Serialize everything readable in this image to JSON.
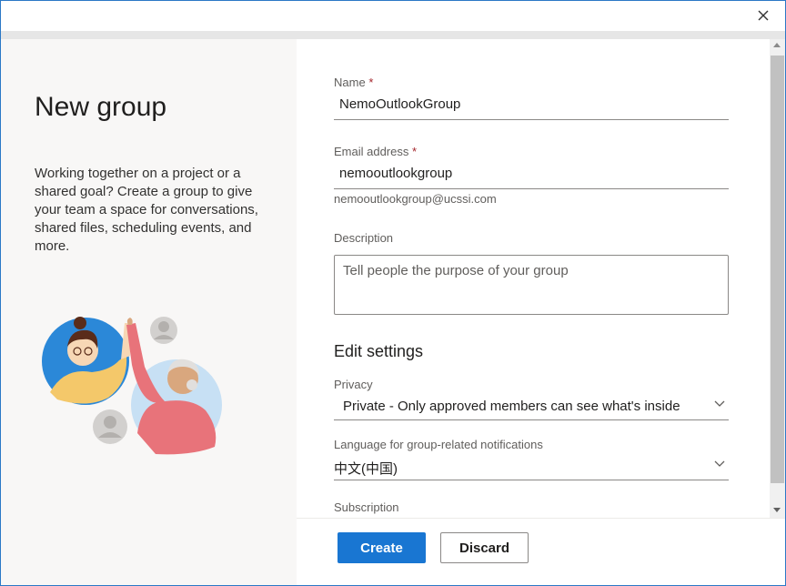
{
  "left": {
    "title": "New group",
    "description": "Working together on a project or a shared goal? Create a group to give your team a space for conversations, shared files, scheduling events, and more."
  },
  "form": {
    "name": {
      "label": "Name",
      "required_mark": "*",
      "value": "NemoOutlookGroup"
    },
    "email": {
      "label": "Email address",
      "required_mark": "*",
      "value": "nemooutlookgroup",
      "hint": "nemooutlookgroup@ucssi.com"
    },
    "description": {
      "label": "Description",
      "placeholder": "Tell people the purpose of your group"
    },
    "settings_title": "Edit settings",
    "privacy": {
      "label": "Privacy",
      "value": "Private - Only approved members can see what's inside"
    },
    "language": {
      "label": "Language for group-related notifications",
      "value": "中文(中国)"
    },
    "subscription": {
      "label": "Subscription"
    }
  },
  "footer": {
    "create_label": "Create",
    "discard_label": "Discard"
  },
  "icons": {
    "close": "close-icon",
    "chevron": "chevron-down-icon"
  },
  "colors": {
    "accent": "#1976d2",
    "required": "#a4262c",
    "left_bg": "#f8f7f6"
  }
}
